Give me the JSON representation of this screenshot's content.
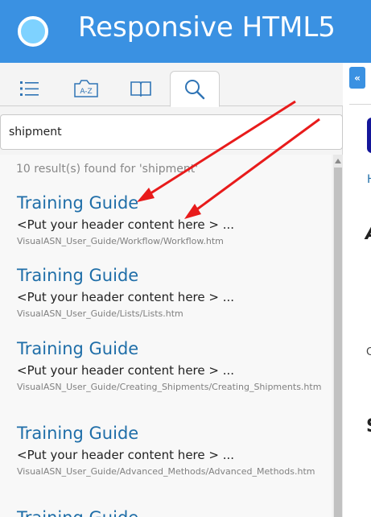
{
  "header": {
    "title": "Responsive HTML5",
    "logo_icon": "circle-logo-icon",
    "color": "#3a91e2"
  },
  "tabs": [
    {
      "name": "toc",
      "icon": "list-icon",
      "active": false
    },
    {
      "name": "index",
      "icon": "az-index-icon",
      "active": false
    },
    {
      "name": "glossary",
      "icon": "book-icon",
      "active": false
    },
    {
      "name": "search",
      "icon": "search-icon",
      "active": true
    }
  ],
  "search": {
    "value": "shipment"
  },
  "results": {
    "summary": "10 result(s) found for 'shipment'",
    "items": [
      {
        "title": "Training Guide",
        "snippet": "<Put your header content here > ...",
        "path": "VisualASN_User_Guide/Workflow/Workflow.htm"
      },
      {
        "title": "Training Guide",
        "snippet": "<Put your header content here > ...",
        "path": "VisualASN_User_Guide/Lists/Lists.htm"
      },
      {
        "title": "Training Guide",
        "snippet": "<Put your header content here > ...",
        "path": "VisualASN_User_Guide/Creating_Shipments/Creating_Shipments.htm"
      },
      {
        "title": "Training Guide",
        "snippet": "<Put your header content here > ...",
        "path": "VisualASN_User_Guide/Advanced_Methods/Advanced_Methods.htm"
      },
      {
        "title": "Training Guide",
        "snippet": "",
        "path": ""
      }
    ]
  },
  "sidebar_toggle": {
    "label": "«"
  },
  "right_panel": {
    "h": "H",
    "a": "A",
    "c": "C",
    "s": "S"
  },
  "colors": {
    "accent": "#3a91e2",
    "link": "#1f6ea8",
    "arrow": "#e81b1b"
  }
}
